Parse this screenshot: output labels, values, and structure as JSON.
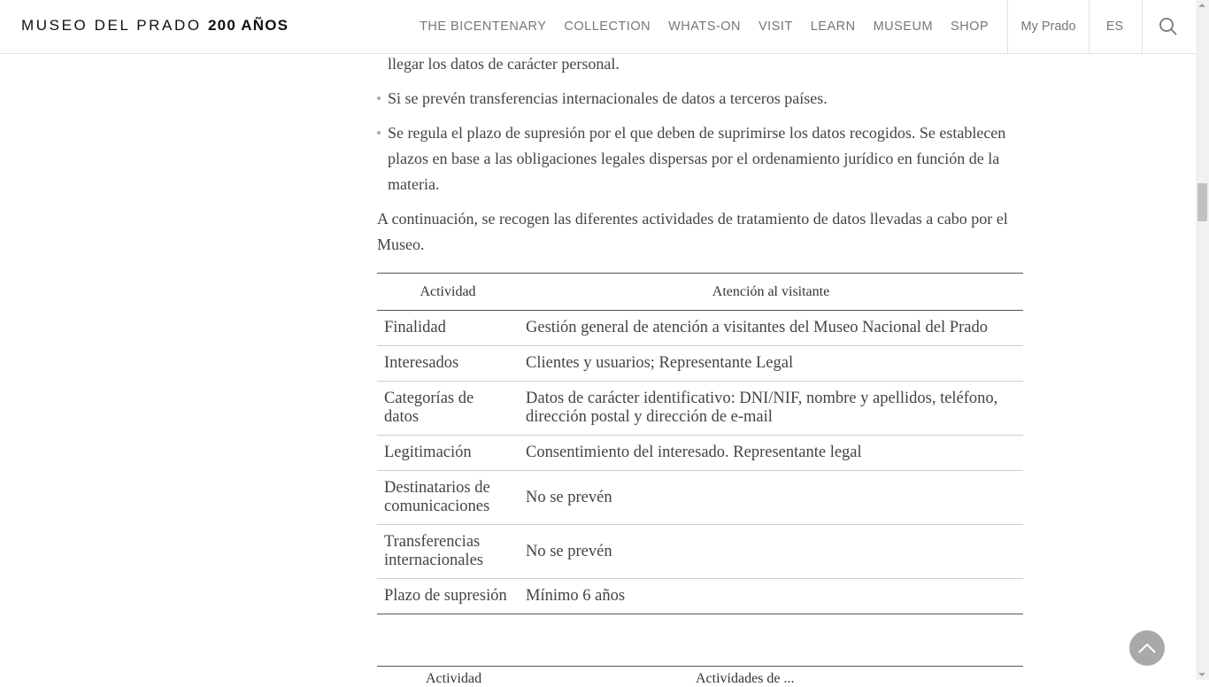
{
  "header": {
    "logo_main": "MUSEO DEL PRADO",
    "logo_bold": "200 AÑOS",
    "nav": [
      "THE BICENTENARY",
      "COLLECTION",
      "WHATS-ON",
      "VISIT",
      "LEARN",
      "MUSEUM",
      "SHOP"
    ],
    "my_prado": "My Prado",
    "lang": "ES",
    "search_icon": "search-icon"
  },
  "content": {
    "partial_line": "llegar los datos de carácter personal.",
    "bullets": [
      "Si se prevén transferencias internacionales de datos a terceros países.",
      "Se regula el plazo de supresión por el que deben de suprimirse los datos recogidos. Se establecen plazos en base a las obligaciones legales dispersas por el ordenamiento jurídico en función de la materia."
    ],
    "intro": "A continuación, se recogen las diferentes actividades de tratamiento de datos llevadas a cabo por el Museo."
  },
  "table": {
    "header": [
      "Actividad",
      "Atención al visitante"
    ],
    "rows": [
      [
        "Finalidad",
        "Gestión general de atención a visitantes del Museo Nacional del Prado"
      ],
      [
        "Interesados",
        "Clientes y usuarios; Representante Legal"
      ],
      [
        "Categorías de datos",
        "Datos de carácter identificativo: DNI/NIF, nombre y apellidos, teléfono, dirección postal y dirección de e-mail"
      ],
      [
        "Legitimación",
        "Consentimiento del interesado. Representante legal"
      ],
      [
        "Destinatarios de comunicaciones",
        "No se prevén"
      ],
      [
        "Transferencias internacionales",
        "No se prevén"
      ],
      [
        "Plazo de supresión",
        "Mínimo 6 años"
      ]
    ]
  },
  "table2_header": [
    "Actividad",
    "Actividades de ..."
  ],
  "to_top_icon": "chevron-up-icon"
}
